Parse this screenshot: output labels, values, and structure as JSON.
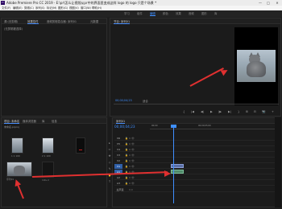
{
  "window": {
    "title": "Adobe Premiere Pro CC 2019 - E:\\pr\\怎么让视频从pr中的界面里变成这样 logo 的 logo 只是个场景 *",
    "minimize": "—",
    "maximize": "□",
    "close": "✕"
  },
  "menu": [
    "文件(F)",
    "编辑(E)",
    "剪辑(C)",
    "序列(S)",
    "标记(M)",
    "图形(G)",
    "视图(V)",
    "窗口(W)",
    "帮助(H)"
  ],
  "workspace_tabs": [
    {
      "label": "学习",
      "active": false
    },
    {
      "label": "组件",
      "active": false
    },
    {
      "label": "编辑",
      "active": true
    },
    {
      "label": "颜色",
      "active": false
    },
    {
      "label": "效果",
      "active": false
    },
    {
      "label": "音频",
      "active": false
    },
    {
      "label": "图形",
      "active": false
    },
    {
      "label": "库",
      "active": false
    }
  ],
  "source_panel": {
    "tabs": [
      "源:(无剪辑)",
      "效果控件",
      "音频剪辑混合器: 序列01",
      "元数据"
    ],
    "active_tab": 1,
    "subtitle": "(无剪辑被选择)"
  },
  "program_monitor": {
    "tab": "节目: 序列01",
    "timecode": "00;00;04;23",
    "fit": "适合",
    "transport": [
      "{",
      "|◀",
      "◀|",
      "▶",
      "|▶",
      "▶|",
      "}",
      "⊞",
      "⊟",
      "📷",
      "+"
    ]
  },
  "project_panel": {
    "tabs": [
      "项目: 未命名",
      "媒体浏览器",
      "库",
      "信息"
    ],
    "path": "未命名.prproj",
    "items": [
      {
        "label": "1 1 100"
      },
      {
        "label": "2 1 100"
      },
      {
        "label": ""
      },
      {
        "label": "序列01"
      },
      {
        "label": "m4v 2"
      }
    ]
  },
  "tools": [
    "▸",
    "⇔",
    "✥",
    "◇",
    "✎",
    "✋",
    "T"
  ],
  "timeline": {
    "tab": "序列01",
    "timecode": "00;00;04;23",
    "ruler_labels": [
      "00;00",
      "00;00;05;00"
    ],
    "tracks": [
      {
        "label": "V6",
        "highlight": false
      },
      {
        "label": "V5",
        "highlight": false
      },
      {
        "label": "V4",
        "highlight": false
      },
      {
        "label": "V3",
        "highlight": false
      },
      {
        "label": "V2",
        "highlight": false
      },
      {
        "label": "V1",
        "highlight": true
      },
      {
        "label": "A1",
        "highlight": true
      },
      {
        "label": "A2",
        "highlight": false
      },
      {
        "label": "A3",
        "highlight": false
      },
      {
        "label": "主声道",
        "highlight": false
      }
    ],
    "track_icons": "🔒 ⊙ 👁",
    "master_value": "0.0"
  },
  "annotation_color": "#e03030"
}
